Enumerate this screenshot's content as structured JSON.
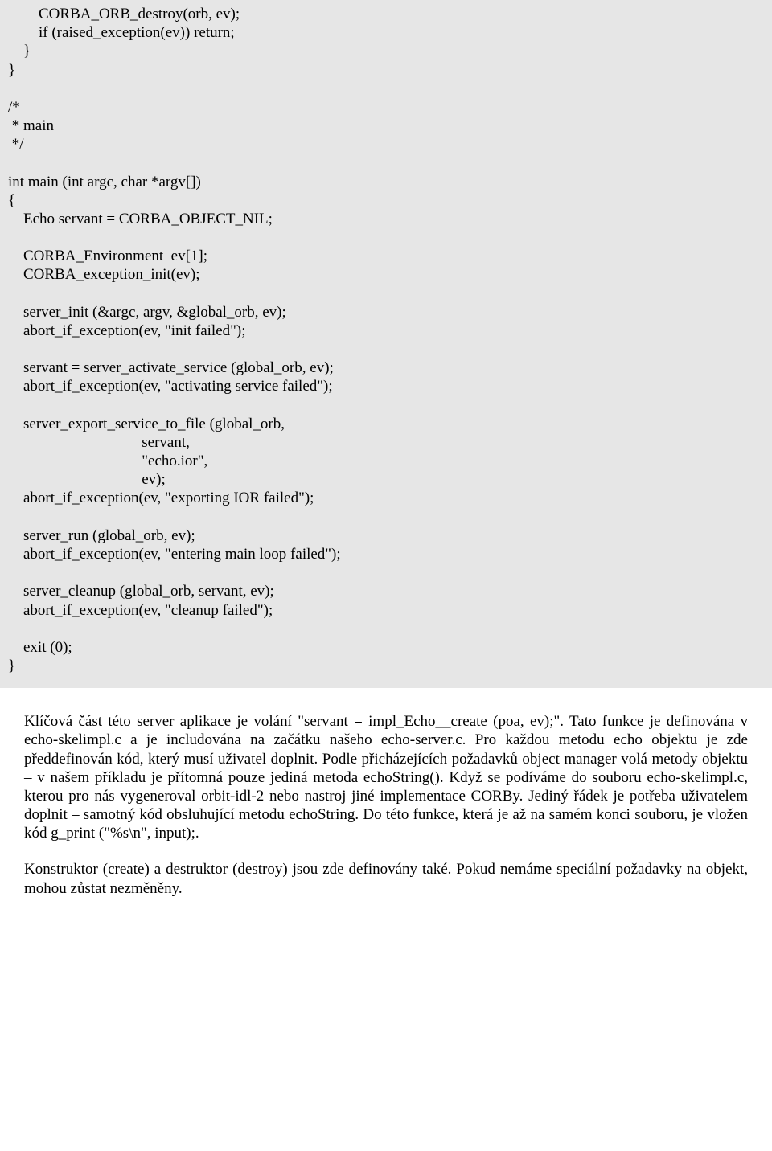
{
  "code": "        CORBA_ORB_destroy(orb, ev);\n        if (raised_exception(ev)) return;\n    }\n}\n\n/*\n * main\n */\n\nint main (int argc, char *argv[])\n{\n    Echo servant = CORBA_OBJECT_NIL;\n\n    CORBA_Environment  ev[1];\n    CORBA_exception_init(ev);\n\n    server_init (&argc, argv, &global_orb, ev);\n    abort_if_exception(ev, \"init failed\");\n\n    servant = server_activate_service (global_orb, ev);\n    abort_if_exception(ev, \"activating service failed\");\n\n    server_export_service_to_file (global_orb,\n                                   servant,\n                                   \"echo.ior\",\n                                   ev);\n    abort_if_exception(ev, \"exporting IOR failed\");\n\n    server_run (global_orb, ev);\n    abort_if_exception(ev, \"entering main loop failed\");\n\n    server_cleanup (global_orb, servant, ev);\n    abort_if_exception(ev, \"cleanup failed\");\n\n    exit (0);\n}",
  "para1": "Klíčová část této server aplikace je volání \"servant = impl_Echo__create (poa, ev);\". Tato funkce je definována v echo-skelimpl.c a je includována na začátku našeho echo-server.c. Pro každou metodu echo objektu je zde předdefinován kód, který musí uživatel doplnit. Podle přicházejících požadavků object manager volá metody objektu – v našem příkladu je přítomná pouze jediná metoda echoString(). Když se podíváme do souboru echo-skelimpl.c, kterou pro nás vygeneroval orbit-idl-2 nebo nastroj jiné implementace CORBy. Jediný řádek je potřeba uživatelem doplnit – samotný kód obsluhující metodu echoString. Do této funkce, která je až na samém konci souboru, je vložen kód g_print (\"%s\\n\", input);.",
  "para2": "Konstruktor (create) a destruktor (destroy) jsou zde definovány také. Pokud nemáme speciální požadavky na objekt, mohou zůstat nezměněny."
}
